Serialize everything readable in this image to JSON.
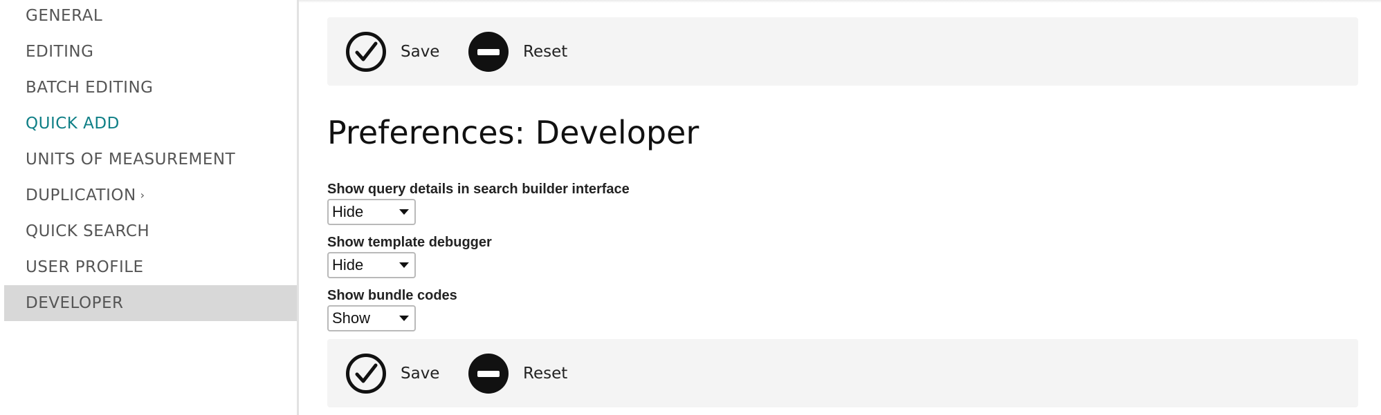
{
  "sidebar": {
    "items": [
      {
        "label": "GENERAL"
      },
      {
        "label": "EDITING"
      },
      {
        "label": "BATCH EDITING"
      },
      {
        "label": "QUICK ADD"
      },
      {
        "label": "UNITS OF MEASUREMENT"
      },
      {
        "label": "DUPLICATION",
        "suffix": "›"
      },
      {
        "label": "QUICK SEARCH"
      },
      {
        "label": "USER PROFILE"
      },
      {
        "label": "DEVELOPER"
      }
    ]
  },
  "toolbar": {
    "save_label": "Save",
    "reset_label": "Reset"
  },
  "page": {
    "title": "Preferences: Developer"
  },
  "form": {
    "fields": [
      {
        "label": "Show query details in search builder interface",
        "value": "Hide"
      },
      {
        "label": "Show template debugger",
        "value": "Hide"
      },
      {
        "label": "Show bundle codes",
        "value": "Show"
      }
    ]
  },
  "colors": {
    "active_nav": "#0f7f86",
    "selected_nav_bg": "#d8d8d8",
    "toolbar_bg": "#f4f4f4"
  },
  "icons": {
    "save": "check-circle-icon",
    "reset": "minus-circle-icon"
  }
}
